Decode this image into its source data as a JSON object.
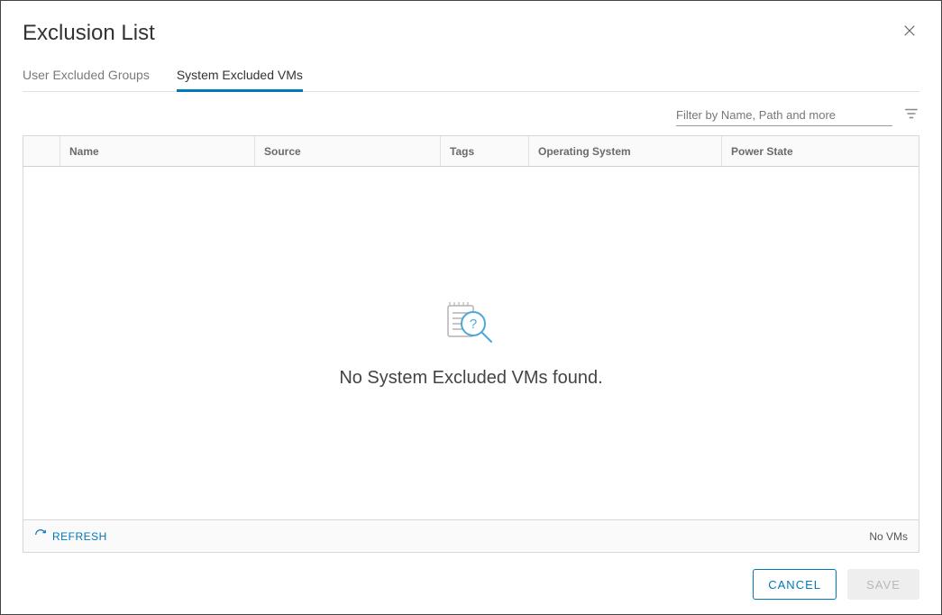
{
  "dialog": {
    "title": "Exclusion List"
  },
  "tabs": {
    "user_excluded": "User Excluded Groups",
    "system_excluded": "System Excluded VMs"
  },
  "filter": {
    "placeholder": "Filter by Name, Path and more"
  },
  "columns": {
    "name": "Name",
    "source": "Source",
    "tags": "Tags",
    "os": "Operating System",
    "power": "Power State"
  },
  "empty": {
    "message": "No System Excluded VMs found."
  },
  "footer": {
    "refresh": "REFRESH",
    "count": "No VMs"
  },
  "actions": {
    "cancel": "CANCEL",
    "save": "SAVE"
  }
}
